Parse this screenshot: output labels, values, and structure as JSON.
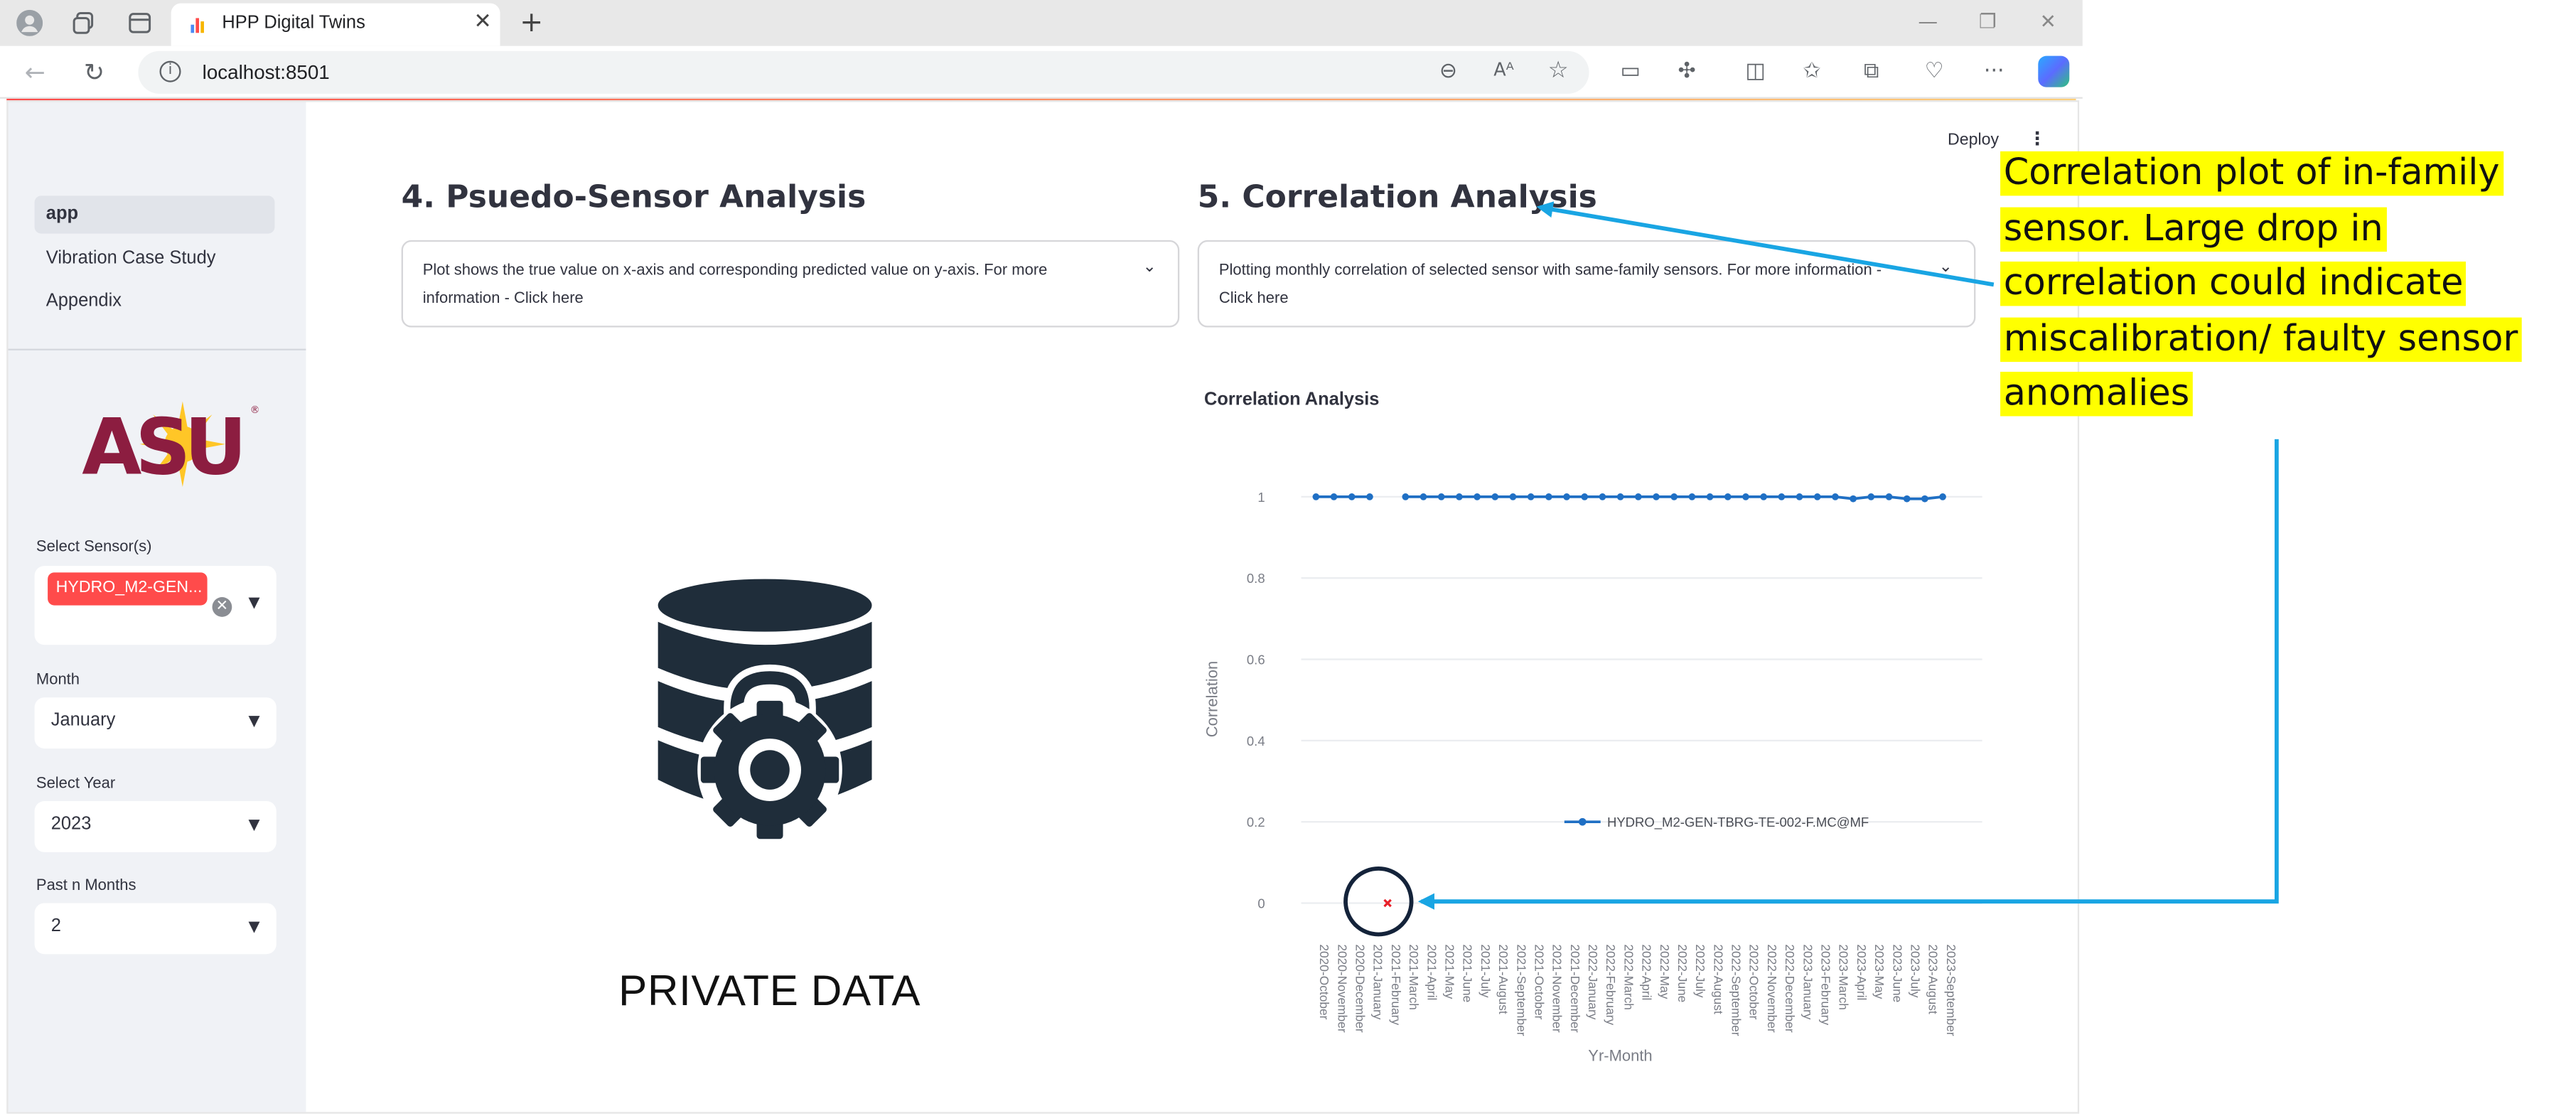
{
  "browser": {
    "tab_title": "HPP Digital Twins",
    "url": "localhost:8501"
  },
  "sidebar": {
    "nav": [
      {
        "label": "app",
        "active": true
      },
      {
        "label": "Vibration Case Study",
        "active": false
      },
      {
        "label": "Appendix",
        "active": false
      }
    ],
    "logo_text": "ASU",
    "sensor_label": "Select Sensor(s)",
    "sensor_tag": "HYDRO_M2-GEN...",
    "month_label": "Month",
    "month_value": "January",
    "year_label": "Select Year",
    "year_value": "2023",
    "past_label": "Past n Months",
    "past_value": "2"
  },
  "header": {
    "deploy_label": "Deploy"
  },
  "section4": {
    "title": "4. Psuedo-Sensor Analysis",
    "expander_text": "Plot shows the true value on x-axis and corresponding predicted value on y-axis. For more information - Click here",
    "private_label": "PRIVATE DATA"
  },
  "section5": {
    "title": "5. Correlation Analysis",
    "expander_text": "Plotting monthly correlation of selected sensor with same-family sensors. For more information - Click here"
  },
  "chart_data": {
    "type": "line",
    "title": "Correlation Analysis",
    "xlabel": "Yr-Month",
    "ylabel": "Correlation",
    "ylim": [
      0,
      1
    ],
    "yticks": [
      "0",
      "0.2",
      "0.4",
      "0.6",
      "0.8",
      "1"
    ],
    "grid": true,
    "legend_position": "inside-bottom-center",
    "categories": [
      "2020-October",
      "2020-November",
      "2020-December",
      "2021-January",
      "2021-February",
      "2021-March",
      "2021-April",
      "2021-May",
      "2021-June",
      "2021-July",
      "2021-August",
      "2021-September",
      "2021-October",
      "2021-November",
      "2021-December",
      "2022-January",
      "2022-February",
      "2022-March",
      "2022-April",
      "2022-May",
      "2022-June",
      "2022-July",
      "2022-August",
      "2022-September",
      "2022-October",
      "2022-November",
      "2022-December",
      "2023-January",
      "2023-February",
      "2023-March",
      "2023-April",
      "2023-May",
      "2023-June",
      "2023-July",
      "2023-August",
      "2023-September"
    ],
    "series": [
      {
        "name": "HYDRO_M2-GEN-TBRG-TE-002-F.MC@MF",
        "color": "#1f6fc4",
        "values": [
          1,
          1,
          1,
          1,
          null,
          1,
          1,
          1,
          1,
          1,
          1,
          1,
          1,
          1,
          1,
          1,
          1,
          1,
          1,
          1,
          1,
          1,
          1,
          1,
          1,
          1,
          1,
          1,
          1,
          1,
          0.995,
          1,
          1,
          0.995,
          0.995,
          1
        ]
      }
    ],
    "anomaly": {
      "category": "2021-February",
      "value": 0,
      "color": "#e8202a",
      "marker": "x"
    }
  },
  "annotation": {
    "text": "Correlation plot of in-family sensor. Large drop in correlation could indicate miscalibration/ faulty sensor anomalies",
    "highlight_color": "#ffff00",
    "arrow_color": "#19a5e3"
  }
}
